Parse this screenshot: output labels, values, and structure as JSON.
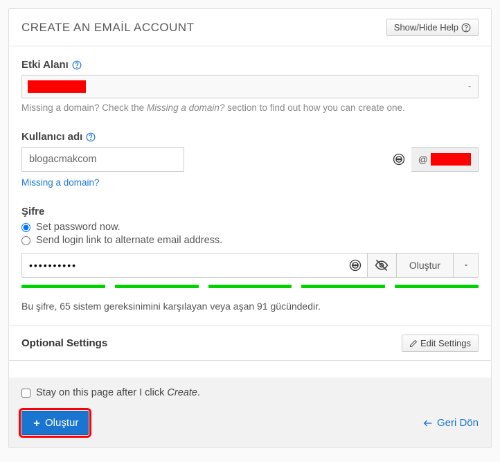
{
  "header": {
    "title": "CREATE AN EMAİL ACCOUNT",
    "help_button": "Show/Hide Help"
  },
  "domain": {
    "label": "Etki Alanı",
    "selected": "",
    "missing_text_pre": "Missing a domain? Check the ",
    "missing_text_em": "Missing a domain?",
    "missing_text_post": " section to find out how you can create one."
  },
  "username": {
    "label": "Kullanıcı adı",
    "value": "blogacmakcom",
    "at": "@",
    "missing_link": "Missing a domain?"
  },
  "password": {
    "label": "Şifre",
    "option_now": "Set password now.",
    "option_link": "Send login link to alternate email address.",
    "value": "••••••••••",
    "generate": "Oluştur",
    "strength_text": "Bu şifre, 65 sistem gereksinimini karşılayan veya aşan 91 gücündedir."
  },
  "optional": {
    "title": "Optional Settings",
    "edit_button": "Edit Settings"
  },
  "footer": {
    "stay_text_pre": "Stay on this page after I click ",
    "stay_text_em": "Create",
    "stay_text_post": ".",
    "create_button": "Oluştur",
    "back_link": "Geri Dön"
  }
}
